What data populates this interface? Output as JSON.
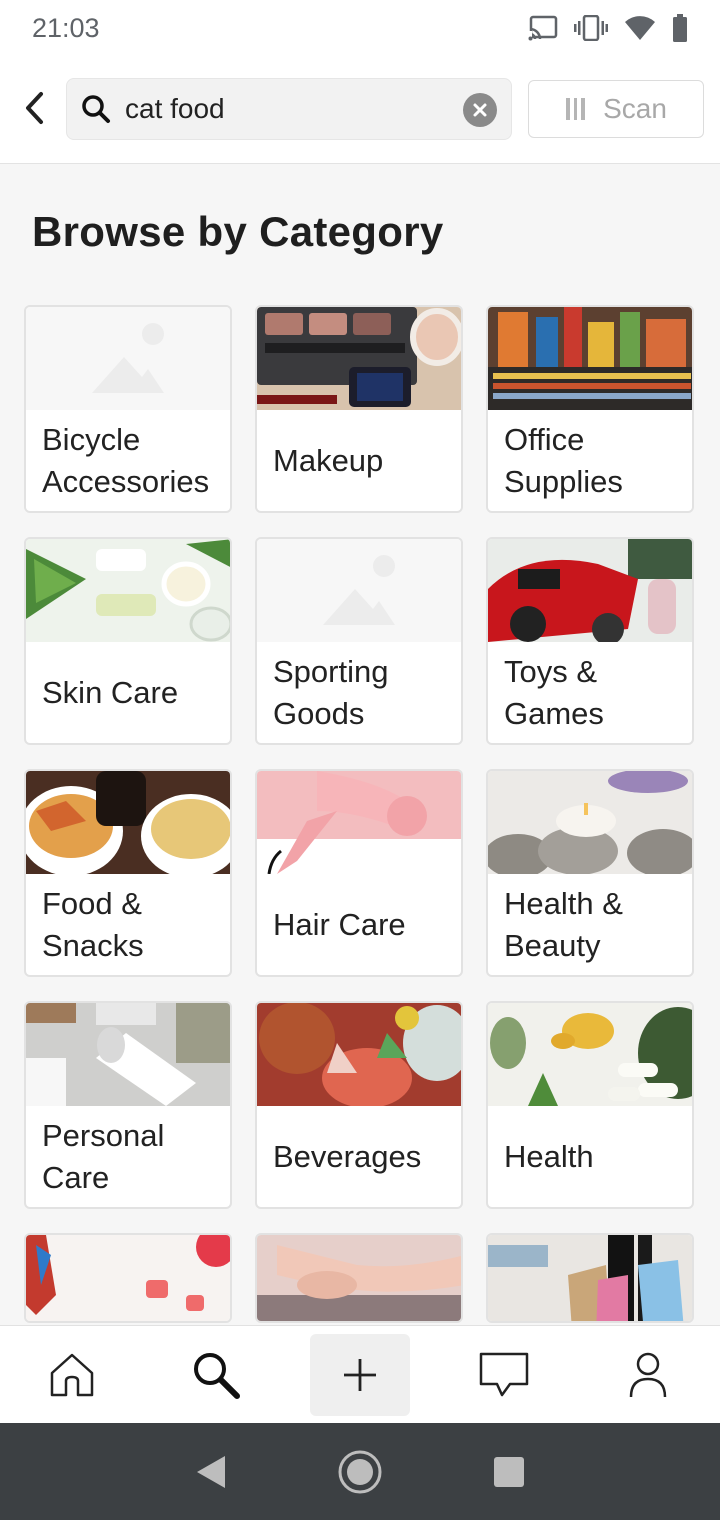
{
  "status_bar": {
    "time": "21:03",
    "icons": [
      "cast-icon",
      "vibrate-icon",
      "wifi-icon",
      "battery-icon"
    ]
  },
  "search": {
    "query": "cat food",
    "placeholder": "",
    "scan_label": "Scan"
  },
  "page": {
    "title": "Browse by Category"
  },
  "categories": [
    {
      "label": "Bicycle Accessories",
      "image": "placeholder"
    },
    {
      "label": "Makeup",
      "image": "makeup-photo"
    },
    {
      "label": "Office Supplies",
      "image": "office-supplies-photo"
    },
    {
      "label": "Skin Care",
      "image": "skin-care-photo"
    },
    {
      "label": "Sporting Goods",
      "image": "placeholder"
    },
    {
      "label": "Toys & Games",
      "image": "toys-photo"
    },
    {
      "label": "Food & Snacks",
      "image": "food-snacks-photo"
    },
    {
      "label": "Hair Care",
      "image": "hair-dryer-photo"
    },
    {
      "label": "Health & Beauty",
      "image": "spa-candle-photo"
    },
    {
      "label": "Personal Care",
      "image": "deodorant-photo"
    },
    {
      "label": "Beverages",
      "image": "drinks-photo"
    },
    {
      "label": "Health",
      "image": "vitamins-photo"
    }
  ],
  "partial_cards": [
    "pet-toys-photo",
    "holding-hands-photo",
    "shopping-bags-photo"
  ],
  "bottom_nav": [
    "home-icon",
    "search-icon",
    "plus-icon",
    "chat-icon",
    "profile-icon"
  ],
  "colors": {
    "background": "#f6f6f6",
    "card_border": "#e2e2e2",
    "system_nav": "#3c4043"
  }
}
